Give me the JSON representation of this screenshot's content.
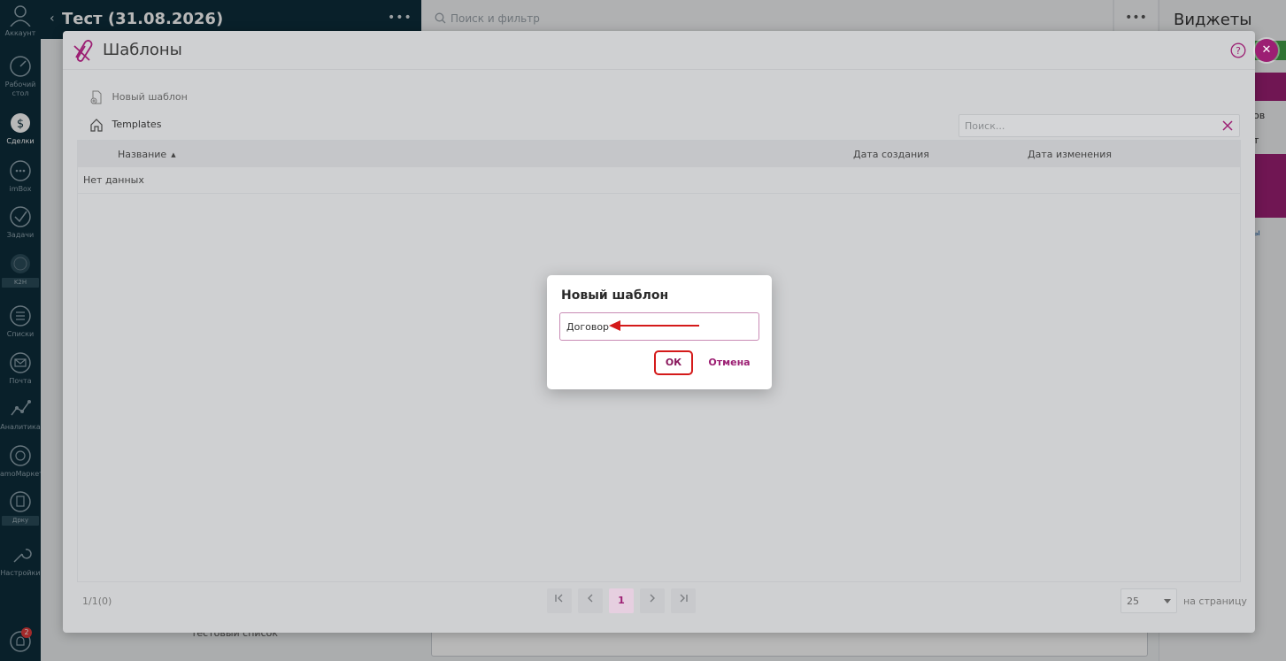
{
  "nav": {
    "account": "Аккаунт",
    "desktop": "Рабочий стол",
    "deals": "Сделки",
    "imbox": "imBox",
    "tasks": "Задачи",
    "k2h": "K2H",
    "lists": "Списки",
    "mail": "Почта",
    "analytics": "Аналитика",
    "market": "amoМаркет",
    "dpku": "Дрку",
    "settings": "Настройки",
    "notifications_count": "2"
  },
  "background": {
    "title": "Тест (31.08.2026)",
    "search_placeholder": "Поиск и фильтр",
    "widgets_title": "Виджеты",
    "list_text": "тестовый список",
    "frag1": "ов",
    "frag2": "т",
    "frag3": "ы"
  },
  "modal": {
    "title": "Шаблоны",
    "new_template_label": "Новый шаблон",
    "breadcrumb": "Templates",
    "search_placeholder": "Поиск...",
    "columns": {
      "name": "Название",
      "created": "Дата создания",
      "modified": "Дата изменения"
    },
    "empty_text": "Нет данных",
    "page_count": "1/1(0)",
    "current_page": "1",
    "per_page_value": "25",
    "per_page_label": "на страницу"
  },
  "dialog": {
    "title": "Новый шаблон",
    "input_value": "Договор",
    "ok_label": "ОК",
    "cancel_label": "Отмена"
  },
  "colors": {
    "accent": "#9c1f73",
    "nav_bg": "#0d2d3b",
    "annotation": "#d41a1a"
  }
}
